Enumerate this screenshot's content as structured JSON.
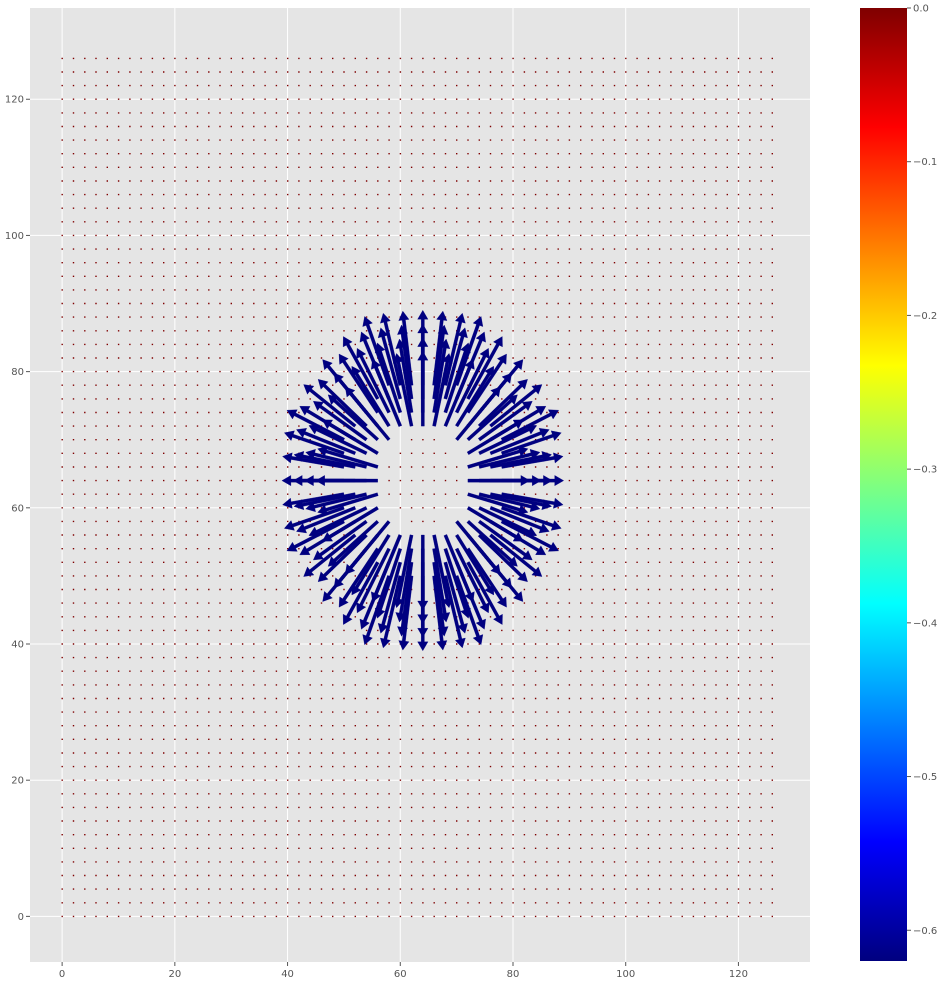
{
  "chart_data": {
    "type": "quiver",
    "title": "",
    "xlabel": "",
    "ylabel": "",
    "xlim": [
      -5.7,
      132.7
    ],
    "ylim": [
      -6.7,
      133.4
    ],
    "xticks": [
      "0",
      "20",
      "40",
      "60",
      "80",
      "100",
      "120"
    ],
    "yticks": [
      "0",
      "20",
      "40",
      "60",
      "80",
      "100",
      "120"
    ],
    "grid": true,
    "background_color": "#e5e5e5",
    "grid_color": "#ffffff",
    "field_grid": {
      "x_min": 0,
      "x_max": 127,
      "y_min": 0,
      "y_max": 127,
      "step": 1
    },
    "zero_vector_color": "#7f0000",
    "vortex": {
      "center": [
        64,
        64
      ],
      "inner_radius": 7.5,
      "outer_radius": 15.5,
      "direction": "radial-outward",
      "value": -0.62,
      "arrow_color": "#000080"
    },
    "colorbar": {
      "colormap": "jet",
      "vmin": -0.62,
      "vmax": 0.0,
      "ticks": [
        {
          "value": 0.0,
          "label": "0.0"
        },
        {
          "value": -0.1,
          "label": "−0.1"
        },
        {
          "value": -0.2,
          "label": "−0.2"
        },
        {
          "value": -0.3,
          "label": "−0.3"
        },
        {
          "value": -0.4,
          "label": "−0.4"
        },
        {
          "value": -0.5,
          "label": "−0.5"
        },
        {
          "value": -0.6,
          "label": "−0.6"
        }
      ]
    }
  }
}
